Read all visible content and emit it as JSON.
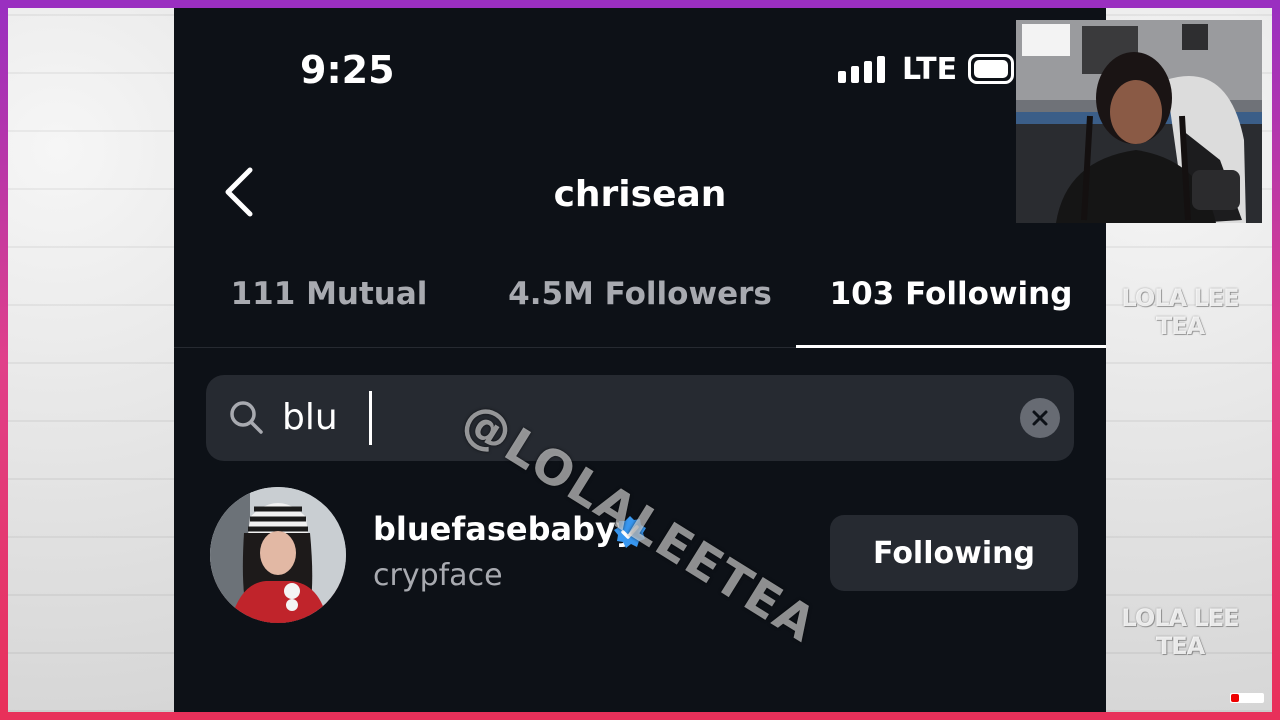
{
  "status": {
    "time": "9:25",
    "network": "LTE"
  },
  "header": {
    "title": "chrisean"
  },
  "tabs": [
    {
      "label": "111 Mutual",
      "active": false
    },
    {
      "label": "4.5M Followers",
      "active": false
    },
    {
      "label": "103 Following",
      "active": true
    }
  ],
  "search": {
    "value": "blu"
  },
  "result": {
    "username": "bluefasebabyy",
    "full_name": "crypface",
    "verified": true,
    "button_label": "Following"
  },
  "watermarks": {
    "diagonal": "@LOLALEETEA",
    "side_1": "LOLA LEE TEA",
    "side_2": "LOLA LEE TEA"
  },
  "colors": {
    "background": "#0d1117",
    "surface": "#262a31",
    "muted_text": "#a8aab0",
    "verified": "#3897f0",
    "frame_gradient_top": "#9a2fc0",
    "frame_gradient_bottom": "#e8305a"
  }
}
